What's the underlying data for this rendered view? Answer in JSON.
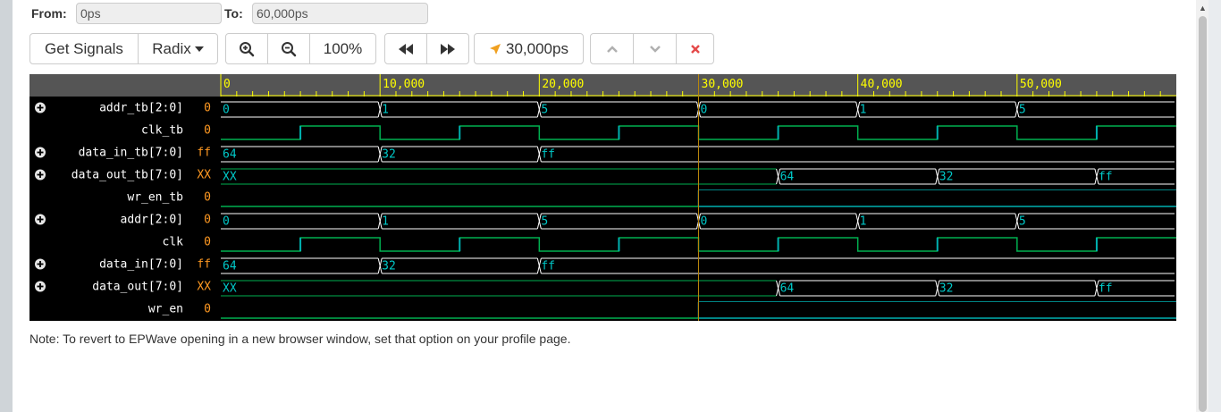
{
  "range": {
    "from_label": "From:",
    "from_value": "0ps",
    "to_label": "To:",
    "to_value": "60,000ps"
  },
  "toolbar": {
    "get_signals": "Get Signals",
    "radix": "Radix",
    "zoom_level": "100%",
    "cursor_time": "30,000ps"
  },
  "ruler": {
    "ticks": [
      {
        "label": "0",
        "t": 0
      },
      {
        "label": "10,000",
        "t": 10000
      },
      {
        "label": "20,000",
        "t": 20000
      },
      {
        "label": "30,000",
        "t": 30000
      },
      {
        "label": "40,000",
        "t": 40000
      },
      {
        "label": "50,000",
        "t": 50000
      }
    ]
  },
  "view": {
    "start": 0,
    "end": 60000,
    "cursor": 30000
  },
  "colors": {
    "bus": "#ffffff",
    "bus_value": "#00c8c8",
    "clock_low": "#00b050",
    "clock_high": "#00b0b0",
    "x_value": "#00b050",
    "names": "#ffffff",
    "current_value": "#ff9922",
    "ruler_text": "#ffff00",
    "cursor": "#b8860b"
  },
  "signals": [
    {
      "name": "addr_tb[2:0]",
      "value": "0",
      "expandable": true,
      "type": "bus",
      "segments": [
        {
          "t": 0,
          "v": "0"
        },
        {
          "t": 10000,
          "v": "1"
        },
        {
          "t": 20000,
          "v": "5"
        },
        {
          "t": 30000,
          "v": "0"
        },
        {
          "t": 40000,
          "v": "1"
        },
        {
          "t": 50000,
          "v": "5"
        }
      ]
    },
    {
      "name": "clk_tb",
      "value": "0",
      "expandable": false,
      "type": "clock",
      "period": 10000
    },
    {
      "name": "data_in_tb[7:0]",
      "value": "ff",
      "expandable": true,
      "type": "bus",
      "segments": [
        {
          "t": 0,
          "v": "64"
        },
        {
          "t": 10000,
          "v": "32"
        },
        {
          "t": 20000,
          "v": "ff"
        }
      ]
    },
    {
      "name": "data_out_tb[7:0]",
      "value": "XX",
      "expandable": true,
      "type": "bus",
      "segments": [
        {
          "t": 0,
          "v": "XX",
          "x": true
        },
        {
          "t": 35000,
          "v": "64"
        },
        {
          "t": 45000,
          "v": "32"
        },
        {
          "t": 55000,
          "v": "ff"
        }
      ]
    },
    {
      "name": "wr_en_tb",
      "value": "0",
      "expandable": false,
      "type": "bit",
      "edges": [
        {
          "t": 0,
          "v": 0
        },
        {
          "t": 30000,
          "v": 1
        }
      ]
    },
    {
      "name": "addr[2:0]",
      "value": "0",
      "expandable": true,
      "type": "bus",
      "segments": [
        {
          "t": 0,
          "v": "0"
        },
        {
          "t": 10000,
          "v": "1"
        },
        {
          "t": 20000,
          "v": "5"
        },
        {
          "t": 30000,
          "v": "0"
        },
        {
          "t": 40000,
          "v": "1"
        },
        {
          "t": 50000,
          "v": "5"
        }
      ]
    },
    {
      "name": "clk",
      "value": "0",
      "expandable": false,
      "type": "clock",
      "period": 10000
    },
    {
      "name": "data_in[7:0]",
      "value": "ff",
      "expandable": true,
      "type": "bus",
      "segments": [
        {
          "t": 0,
          "v": "64"
        },
        {
          "t": 10000,
          "v": "32"
        },
        {
          "t": 20000,
          "v": "ff"
        }
      ]
    },
    {
      "name": "data_out[7:0]",
      "value": "XX",
      "expandable": true,
      "type": "bus",
      "segments": [
        {
          "t": 0,
          "v": "XX",
          "x": true
        },
        {
          "t": 35000,
          "v": "64"
        },
        {
          "t": 45000,
          "v": "32"
        },
        {
          "t": 55000,
          "v": "ff"
        }
      ]
    },
    {
      "name": "wr_en",
      "value": "0",
      "expandable": false,
      "type": "bit",
      "edges": [
        {
          "t": 0,
          "v": 0
        },
        {
          "t": 30000,
          "v": 1
        }
      ]
    }
  ],
  "note": "Note: To revert to EPWave opening in a new browser window, set that option on your profile page."
}
